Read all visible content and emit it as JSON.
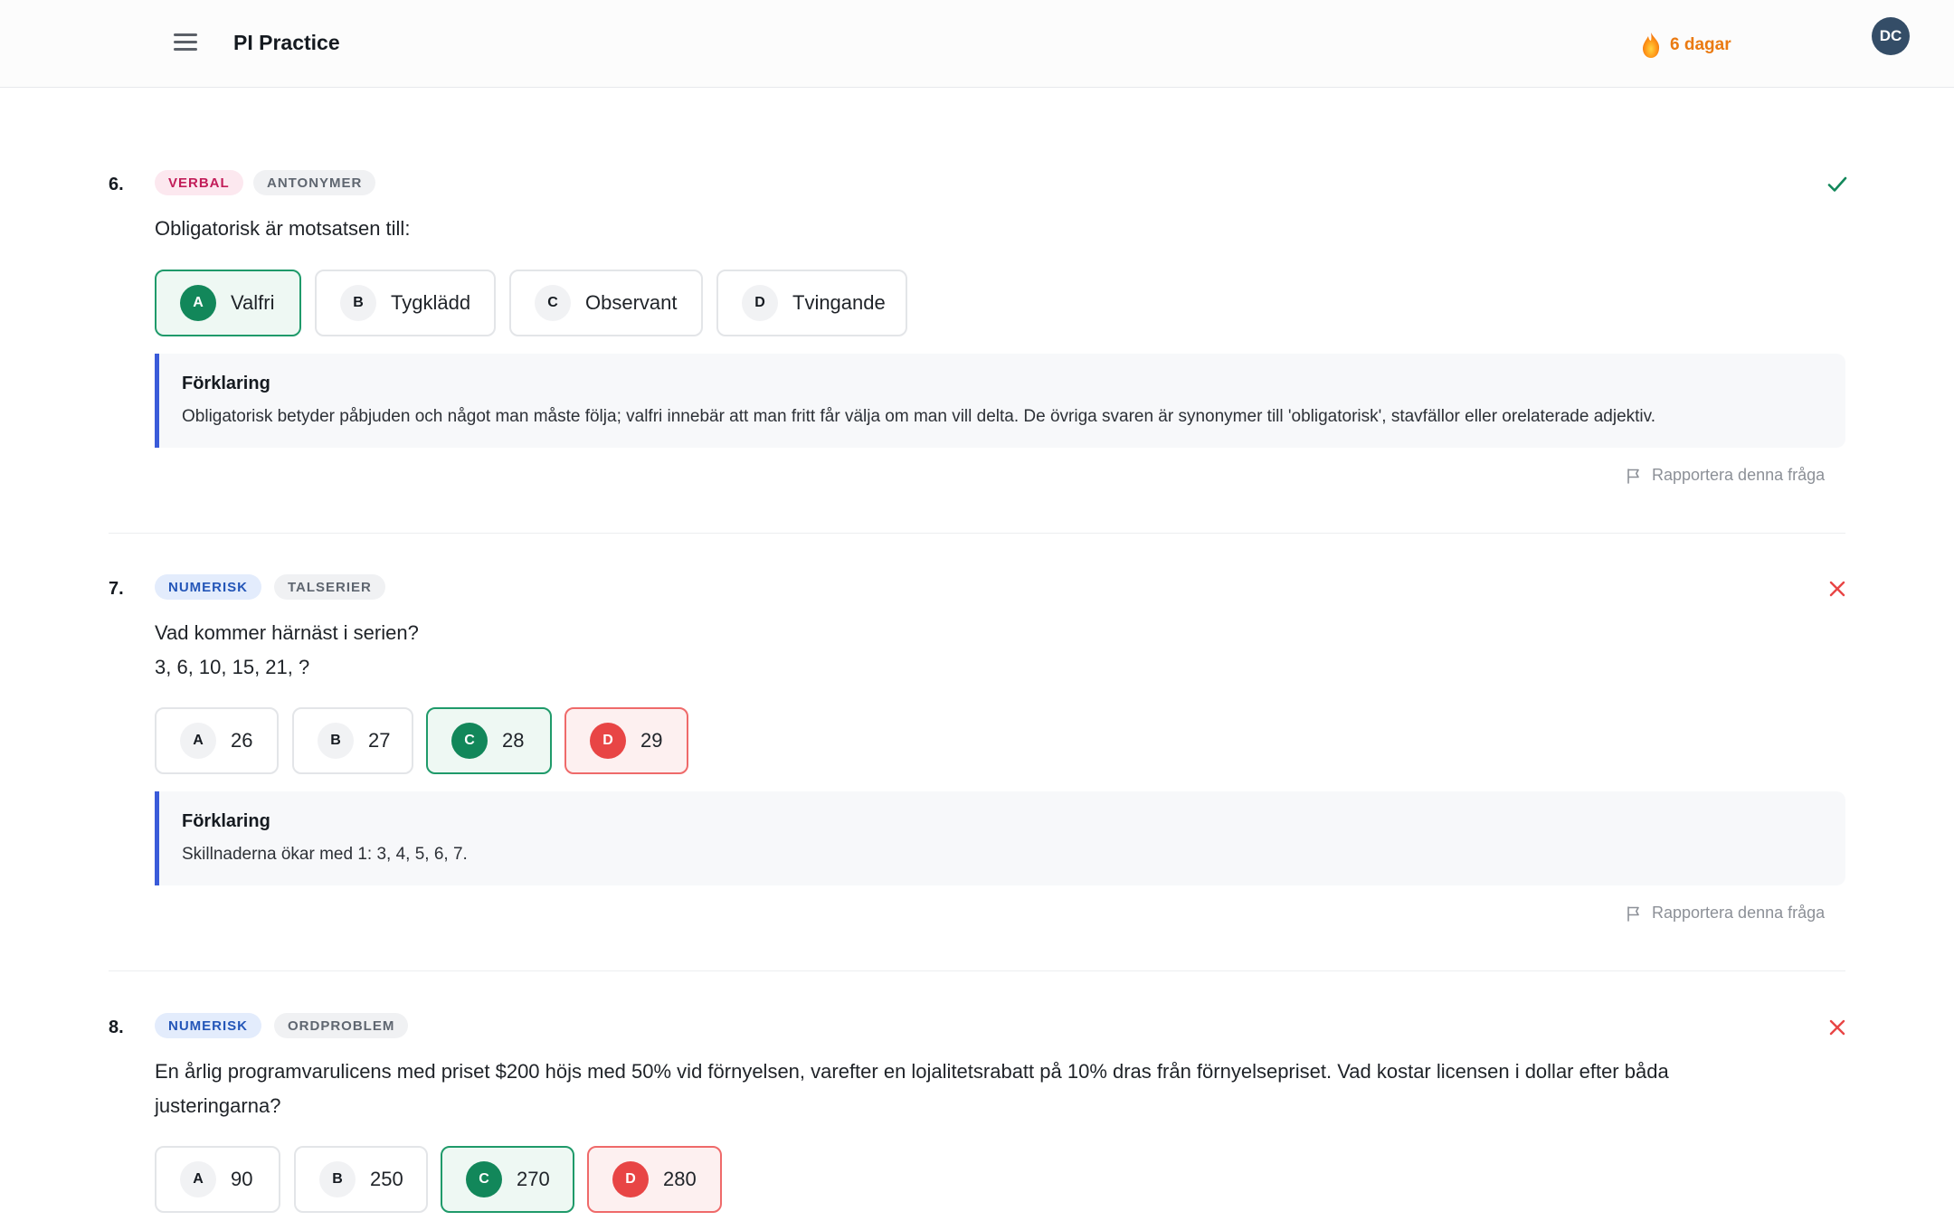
{
  "header": {
    "app_title": "PI Practice",
    "streak_label": "6 dagar",
    "avatar_initials": "DC"
  },
  "questions": [
    {
      "number": "6.",
      "category": "VERBAL",
      "subcategory": "ANTONYMER",
      "status": "correct",
      "text_lines": [
        "Obligatorisk är motsatsen till:"
      ],
      "options": [
        {
          "letter": "A",
          "label": "Valfri",
          "state": "correct"
        },
        {
          "letter": "B",
          "label": "Tygklädd",
          "state": "neutral"
        },
        {
          "letter": "C",
          "label": "Observant",
          "state": "neutral"
        },
        {
          "letter": "D",
          "label": "Tvingande",
          "state": "neutral"
        }
      ],
      "explanation_title": "Förklaring",
      "explanation": "Obligatorisk betyder påbjuden och något man måste följa; valfri innebär att man fritt får välja om man vill delta. De övriga svaren är synonymer till 'obligatorisk', stavfällor eller orelaterade adjektiv.",
      "report_label": "Rapportera denna fråga"
    },
    {
      "number": "7.",
      "category": "NUMERISK",
      "subcategory": "TALSERIER",
      "status": "incorrect",
      "text_lines": [
        "Vad kommer härnäst i serien?",
        "3, 6, 10, 15, 21, ?"
      ],
      "options": [
        {
          "letter": "A",
          "label": "26",
          "state": "neutral"
        },
        {
          "letter": "B",
          "label": "27",
          "state": "neutral"
        },
        {
          "letter": "C",
          "label": "28",
          "state": "correct"
        },
        {
          "letter": "D",
          "label": "29",
          "state": "wrong"
        }
      ],
      "explanation_title": "Förklaring",
      "explanation": "Skillnaderna ökar med 1: 3, 4, 5, 6, 7.",
      "report_label": "Rapportera denna fråga"
    },
    {
      "number": "8.",
      "category": "NUMERISK",
      "subcategory": "ORDPROBLEM",
      "status": "incorrect",
      "text_lines": [
        "En årlig programvarulicens med priset $200 höjs med 50% vid förnyelsen, varefter en lojalitetsrabatt på 10% dras från förnyelsepriset. Vad kostar licensen i dollar efter båda",
        "justeringarna?"
      ],
      "options": [
        {
          "letter": "A",
          "label": "90",
          "state": "neutral"
        },
        {
          "letter": "B",
          "label": "250",
          "state": "neutral"
        },
        {
          "letter": "C",
          "label": "270",
          "state": "correct"
        },
        {
          "letter": "D",
          "label": "280",
          "state": "wrong"
        }
      ]
    }
  ],
  "colors": {
    "correct": "#12875a",
    "wrong": "#e84545",
    "accent_bar": "#3a5bd9",
    "streak": "#ea7a12"
  },
  "icons": {
    "menu": "hamburger-icon",
    "streak": "flame-icon",
    "correct_status": "check-icon",
    "incorrect_status": "close-icon",
    "report": "flag-icon"
  }
}
